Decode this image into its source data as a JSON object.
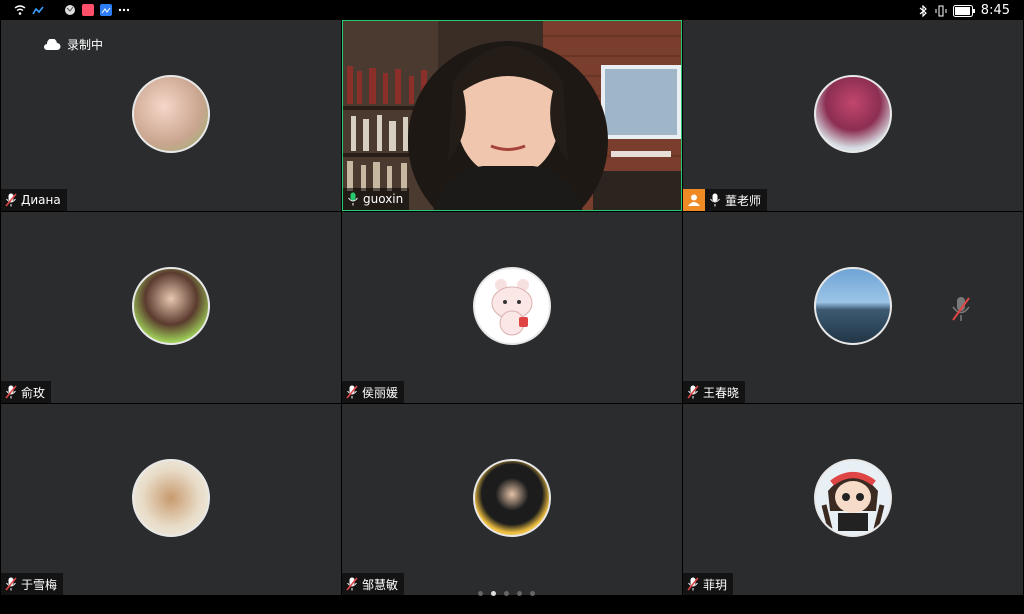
{
  "status_bar": {
    "time": "8:45",
    "left_icons": [
      "wifi-icon",
      "signal-icon",
      "globe-icon",
      "app-icon",
      "gallery-icon",
      "more-dots-icon"
    ],
    "right_icons": [
      "bluetooth-icon",
      "vibrate-icon",
      "battery-icon"
    ]
  },
  "recording": {
    "label": "录制中"
  },
  "participants": [
    {
      "name": "Диана",
      "mic": "muted",
      "avatar": "avatar-photo"
    },
    {
      "name": "guoxin",
      "mic": "active",
      "avatar": "video"
    },
    {
      "name": "董老师",
      "mic": "on",
      "avatar": "avatar-photo",
      "host": true
    },
    {
      "name": "俞玫",
      "mic": "muted",
      "avatar": "avatar-photo"
    },
    {
      "name": "侯丽媛",
      "mic": "muted",
      "avatar": "avatar-cartoon"
    },
    {
      "name": "王春晓",
      "mic": "muted",
      "avatar": "avatar-photo"
    },
    {
      "name": "于雪梅",
      "mic": "muted",
      "avatar": "avatar-photo"
    },
    {
      "name": "邹慧敏",
      "mic": "muted",
      "avatar": "avatar-photo"
    },
    {
      "name": "菲玥",
      "mic": "muted",
      "avatar": "avatar-cartoon"
    }
  ],
  "pager": {
    "pages": 5,
    "current": 2
  },
  "colors": {
    "tile_bg": "#2b2c2e",
    "active_border": "#27c96f",
    "host_badge": "#f08a24",
    "mute_red": "#e04545"
  }
}
